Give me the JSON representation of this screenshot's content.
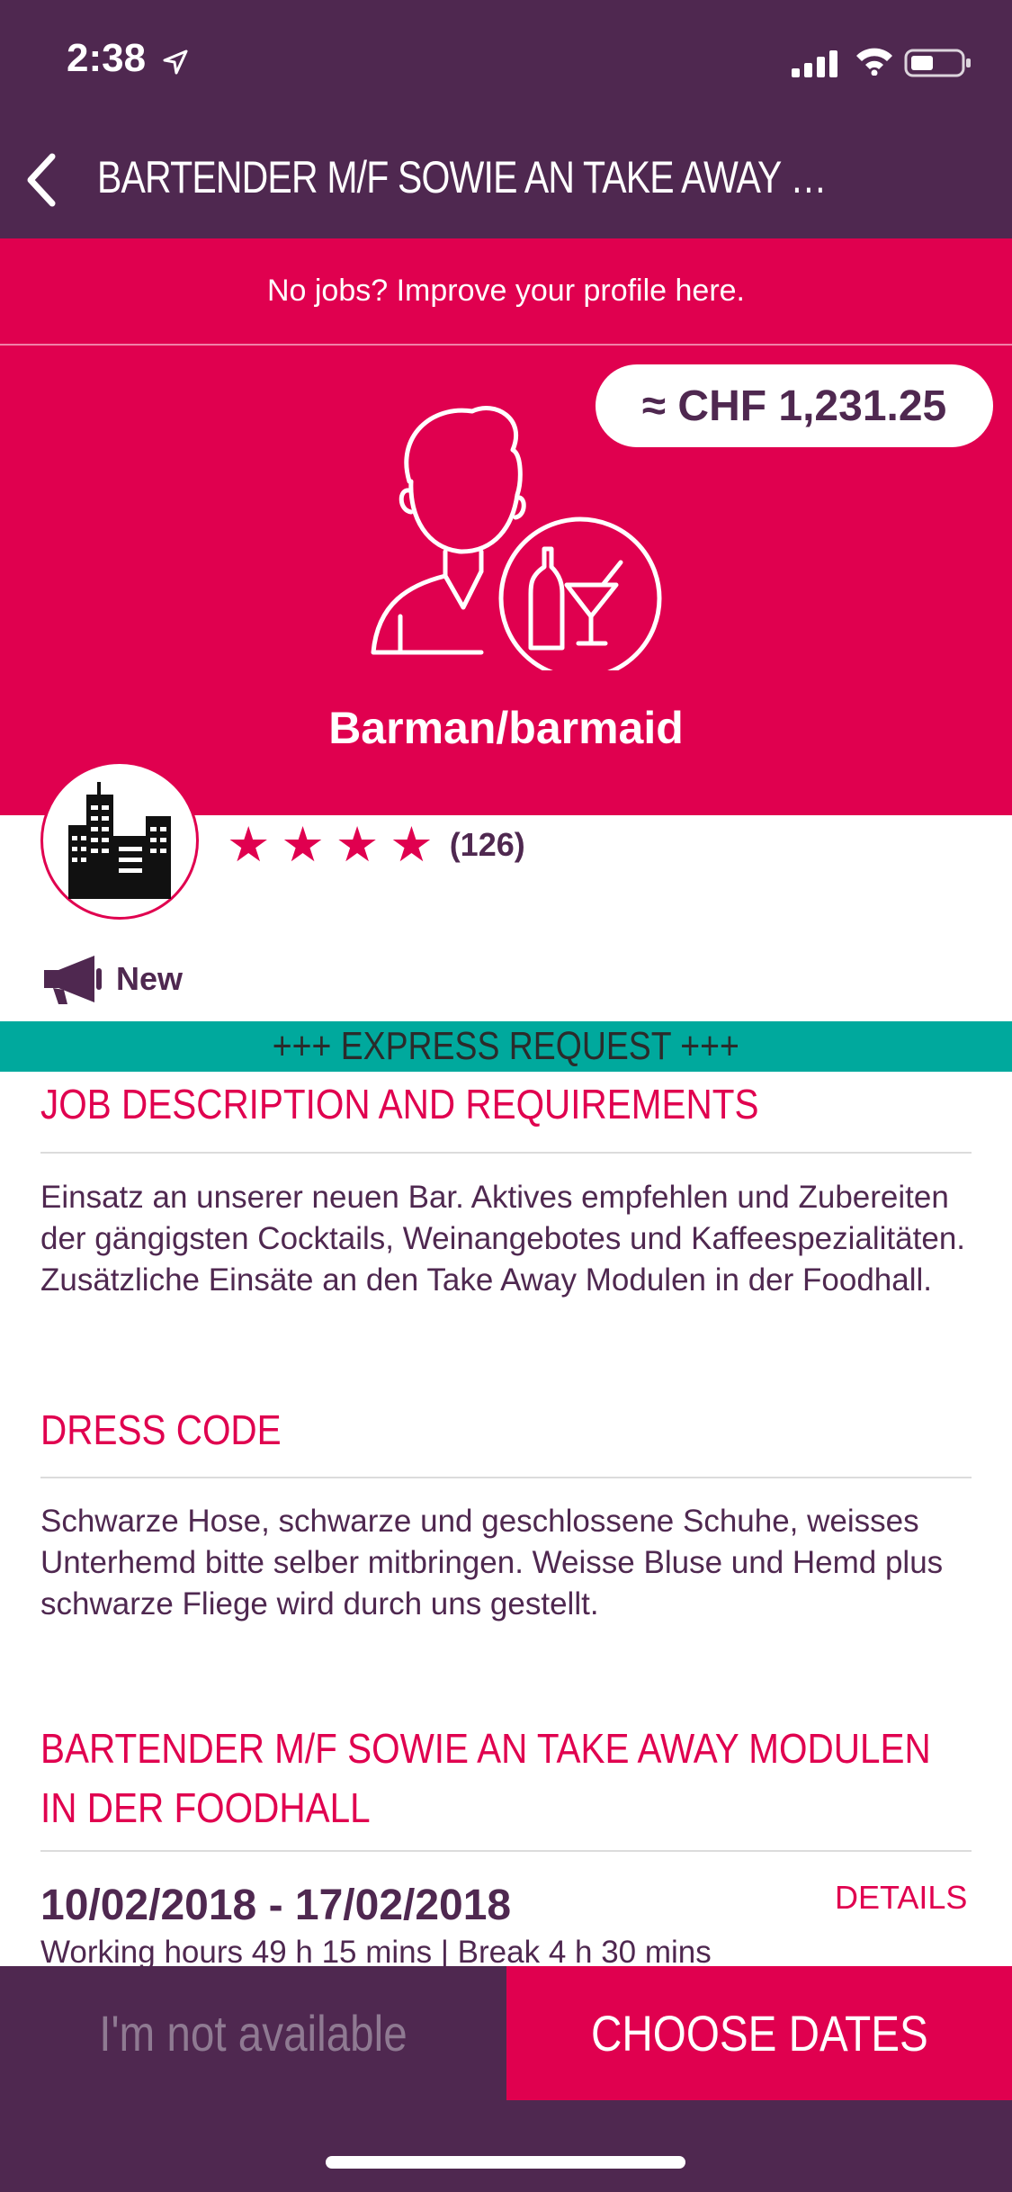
{
  "status_bar": {
    "time": "2:38",
    "icons": [
      "location-arrow-icon",
      "cell-signal-icon",
      "wifi-icon",
      "battery-icon"
    ]
  },
  "nav": {
    "back_icon": "chevron-left-icon",
    "title": "BARTENDER M/F SOWIE AN TAKE AWAY MODULEN IN D..."
  },
  "banner": {
    "text": "No jobs? Improve your profile here."
  },
  "hero": {
    "price": "≈ CHF 1,231.25",
    "icon": "bartender-icon",
    "role": "Barman/barmaid"
  },
  "company": {
    "logo_icon": "city-buildings-icon",
    "rating_stars": 4,
    "rating_count": "(126)",
    "new_icon": "megaphone-icon",
    "new_label": "New"
  },
  "express": {
    "text": "+++ EXPRESS REQUEST +++"
  },
  "sections": {
    "description": {
      "title": "JOB DESCRIPTION AND REQUIREMENTS",
      "text": "Einsatz an unserer neuen Bar. Aktives empfehlen und Zubereiten der gängigsten Cocktails, Weinangebotes und Kaffeespezialitäten. Zusätzliche Einsäte an den Take Away Modulen in der Foodhall."
    },
    "dress_code": {
      "title": "DRESS CODE",
      "text": "Schwarze Hose, schwarze und geschlossene Schuhe, weisses Unterhemd bitte selber mitbringen. Weisse Bluse und Hemd plus schwarze Fliege wird durch uns gestellt."
    },
    "job": {
      "title": "BARTENDER M/F SOWIE AN TAKE AWAY MODULEN IN DER FOODHALL",
      "dates": "10/02/2018 - 17/02/2018",
      "details_label": "DETAILS",
      "hours": "Working hours 49 h 15 mins |  Break 4 h 30 mins"
    }
  },
  "actions": {
    "not_available": "I'm not available",
    "choose_dates": "CHOOSE DATES"
  },
  "colors": {
    "brand_purple": "#4f2850",
    "brand_pink": "#e0004f",
    "express_teal": "#00a99d"
  }
}
